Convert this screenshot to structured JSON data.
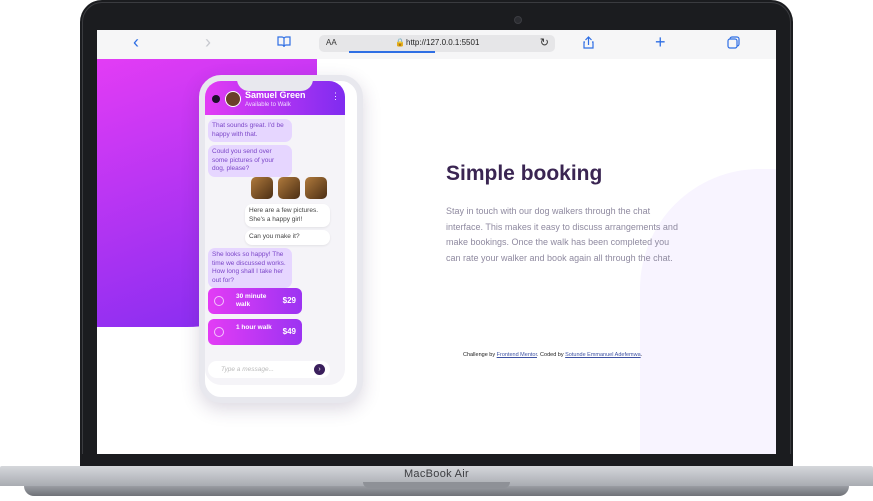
{
  "browser": {
    "reader_label": "AA",
    "url": "http://127.0.0.1:5501"
  },
  "phone": {
    "contact_name": "Samuel Green",
    "contact_status": "Available to Walk",
    "messages": [
      {
        "text": "That sounds great. I'd be happy with that."
      },
      {
        "text": "Could you send over some pictures of your dog, please?"
      },
      {
        "text": "Here are a few pictures. She's a happy girl!"
      },
      {
        "text": "Can you make it?"
      },
      {
        "text": "She looks so happy! The time we discussed works. How long shall I take her out for?"
      }
    ],
    "offers": [
      {
        "label": "30 minute walk",
        "price": "$29"
      },
      {
        "label": "1 hour walk",
        "price": "$49"
      }
    ],
    "message_placeholder": "Type a message..."
  },
  "content": {
    "title": "Simple booking",
    "body": "Stay in touch with our dog walkers through the chat interface. This makes it easy to discuss arrangements and make bookings. Once the walk has been completed you can rate your walker and book again all through the chat."
  },
  "attribution": {
    "prefix": "Challenge by",
    "link1": "Frontend Mentor",
    "middle": ". Coded by",
    "link2": "Sotunde Emmanuel Adefemwa",
    "suffix": "."
  },
  "device": {
    "brand": "MacBook Air"
  }
}
